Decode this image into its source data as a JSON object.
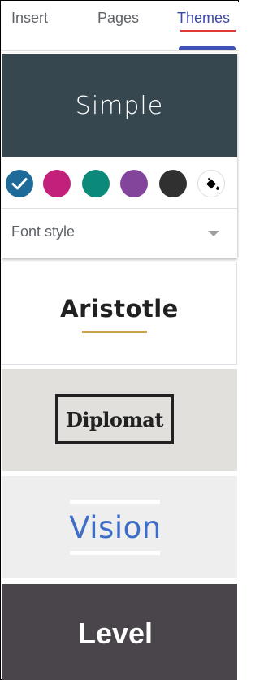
{
  "tabs": [
    {
      "label": "Insert",
      "active": false
    },
    {
      "label": "Pages",
      "active": false
    },
    {
      "label": "Themes",
      "active": true
    }
  ],
  "colors": {
    "accent": "#3f51b5",
    "active_tab_text": "#3c4aa8",
    "tab_text": "#5f6368",
    "spelling_underline": "#e53935"
  },
  "themes": {
    "simple": {
      "label": "Simple",
      "background": "#37474f",
      "selected": true,
      "swatches": [
        {
          "color": "#1e6b9a",
          "selected": true,
          "icon": "check-icon"
        },
        {
          "color": "#c2207a",
          "selected": false
        },
        {
          "color": "#0b8a7a",
          "selected": false
        },
        {
          "color": "#83449c",
          "selected": false
        },
        {
          "color": "#303030",
          "selected": false
        }
      ],
      "custom_color_icon": "paint-bucket-icon",
      "font_style": {
        "label": "Font style",
        "icon": "dropdown-caret-icon"
      }
    },
    "aristotle": {
      "label": "Aristotle",
      "accent": "#c9a24e"
    },
    "diplomat": {
      "label": "Diplomat",
      "background": "#e2e0dc"
    },
    "vision": {
      "label": "Vision",
      "color": "#3e6dc9",
      "background": "#eeeeee"
    },
    "level": {
      "label": "Level",
      "background": "#4a444b"
    }
  }
}
